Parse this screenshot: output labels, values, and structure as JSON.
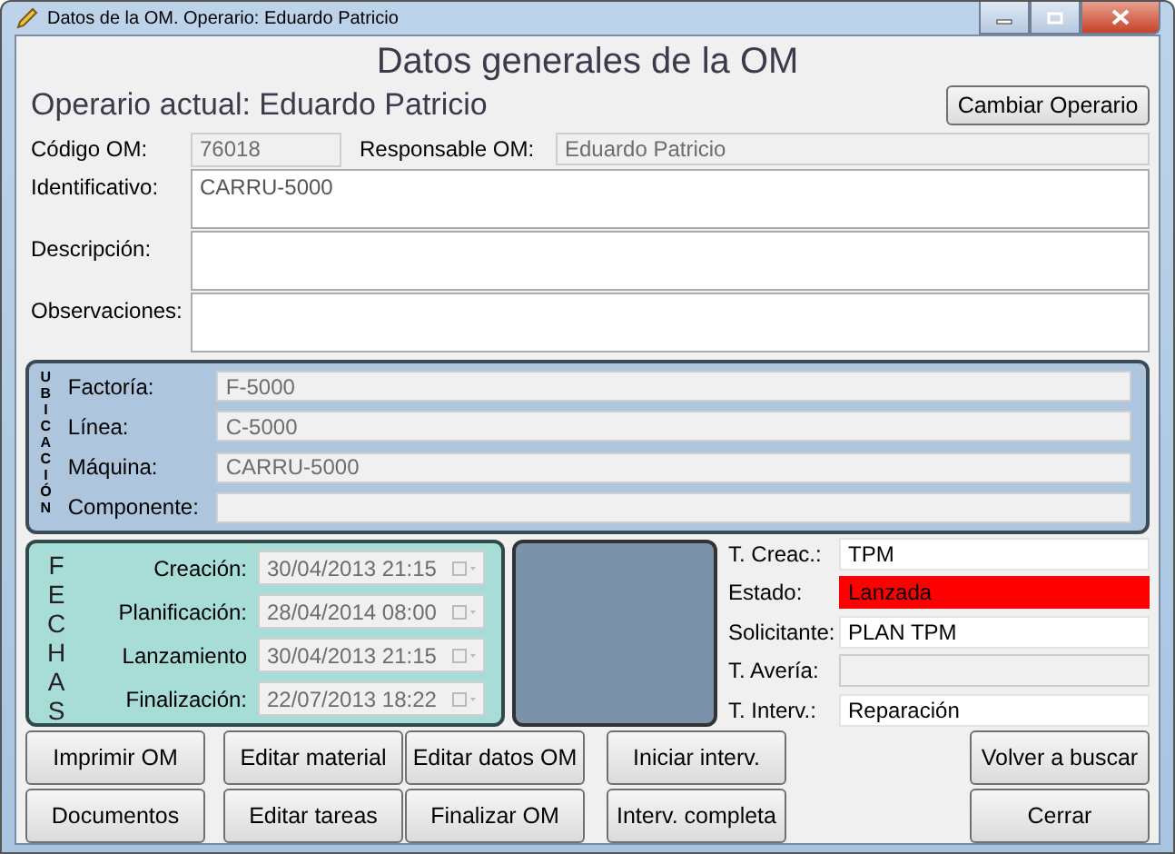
{
  "window": {
    "title": "Datos de la OM. Operario: Eduardo Patricio"
  },
  "heading": "Datos generales de la OM",
  "operator": {
    "label": "Operario actual: Eduardo Patricio",
    "button": "Cambiar Operario"
  },
  "codigo": {
    "label": "Código OM:",
    "value": "76018",
    "disabled": true
  },
  "responsable": {
    "label": "Responsable OM:",
    "value": "Eduardo Patricio",
    "disabled": true
  },
  "text_fields": [
    {
      "label": "Identificativo:",
      "value": "CARRU-5000"
    },
    {
      "label": "Descripción:"
    },
    {
      "label": "Observaciones:"
    }
  ],
  "ubicacion": {
    "title": "UBICACIÓN",
    "fields": [
      {
        "label": "Factoría:",
        "value": "F-5000",
        "disabled": true
      },
      {
        "label": "Línea:",
        "value": "C-5000",
        "disabled": true
      },
      {
        "label": "Máquina:",
        "value": "CARRU-5000",
        "disabled": true
      },
      {
        "label": "Componente:",
        "disabled": true
      }
    ]
  },
  "fechas": {
    "title": "FECHAS",
    "fields": [
      {
        "label": "Creación:",
        "value": "30/04/2013 21:15",
        "disabled": true
      },
      {
        "label": "Planificación:",
        "value": "28/04/2014 08:00",
        "disabled": true
      },
      {
        "label": "Lanzamiento",
        "value": "30/04/2013 21:15",
        "disabled": true
      },
      {
        "label": "Finalización:",
        "value": "22/07/2013 18:22",
        "disabled": true
      }
    ]
  },
  "info_fields": [
    {
      "label": "T. Creac.:",
      "value": "TPM",
      "disabled": false
    },
    {
      "label": "Estado:",
      "value": "Lanzada",
      "disabled": false,
      "color": "#ff0000"
    },
    {
      "label": "Solicitante:",
      "value": "PLAN TPM",
      "disabled": false
    },
    {
      "label": "T. Avería:",
      "disabled": true
    },
    {
      "label": "T. Interv.:",
      "value": "Reparación",
      "disabled": false
    }
  ],
  "button_columns": [
    [
      "Imprimir OM",
      "Documentos"
    ],
    [
      "Editar material",
      "Editar tareas"
    ],
    [
      "Editar datos OM",
      "Finalizar OM"
    ],
    [
      "Iniciar interv.",
      "Interv. completa"
    ],
    [
      "Volver a buscar",
      "Cerrar"
    ]
  ]
}
